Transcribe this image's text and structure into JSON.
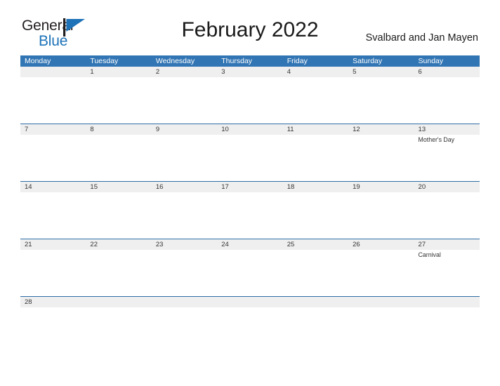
{
  "brand": {
    "line1": "General",
    "line2": "Blue",
    "flag_icon": "flag-icon",
    "color_dark": "#231f20",
    "color_blue": "#1d72b8"
  },
  "header": {
    "title": "February 2022",
    "region": "Svalbard and Jan Mayen"
  },
  "theme": {
    "header_blue": "#3175b4",
    "row_divider_blue": "#2e6da4",
    "band_gray": "#efefef",
    "text": "#333333"
  },
  "calendar": {
    "day_headers": [
      "Monday",
      "Tuesday",
      "Wednesday",
      "Thursday",
      "Friday",
      "Saturday",
      "Sunday"
    ],
    "weeks": [
      {
        "days": [
          {
            "num": "",
            "events": []
          },
          {
            "num": "1",
            "events": []
          },
          {
            "num": "2",
            "events": []
          },
          {
            "num": "3",
            "events": []
          },
          {
            "num": "4",
            "events": []
          },
          {
            "num": "5",
            "events": []
          },
          {
            "num": "6",
            "events": []
          }
        ]
      },
      {
        "days": [
          {
            "num": "7",
            "events": []
          },
          {
            "num": "8",
            "events": []
          },
          {
            "num": "9",
            "events": []
          },
          {
            "num": "10",
            "events": []
          },
          {
            "num": "11",
            "events": []
          },
          {
            "num": "12",
            "events": []
          },
          {
            "num": "13",
            "events": [
              "Mother's Day"
            ]
          }
        ]
      },
      {
        "days": [
          {
            "num": "14",
            "events": []
          },
          {
            "num": "15",
            "events": []
          },
          {
            "num": "16",
            "events": []
          },
          {
            "num": "17",
            "events": []
          },
          {
            "num": "18",
            "events": []
          },
          {
            "num": "19",
            "events": []
          },
          {
            "num": "20",
            "events": []
          }
        ]
      },
      {
        "days": [
          {
            "num": "21",
            "events": []
          },
          {
            "num": "22",
            "events": []
          },
          {
            "num": "23",
            "events": []
          },
          {
            "num": "24",
            "events": []
          },
          {
            "num": "25",
            "events": []
          },
          {
            "num": "26",
            "events": []
          },
          {
            "num": "27",
            "events": [
              "Carnival"
            ]
          }
        ]
      },
      {
        "days": [
          {
            "num": "28",
            "events": []
          },
          {
            "num": "",
            "events": []
          },
          {
            "num": "",
            "events": []
          },
          {
            "num": "",
            "events": []
          },
          {
            "num": "",
            "events": []
          },
          {
            "num": "",
            "events": []
          },
          {
            "num": "",
            "events": []
          }
        ]
      }
    ]
  }
}
